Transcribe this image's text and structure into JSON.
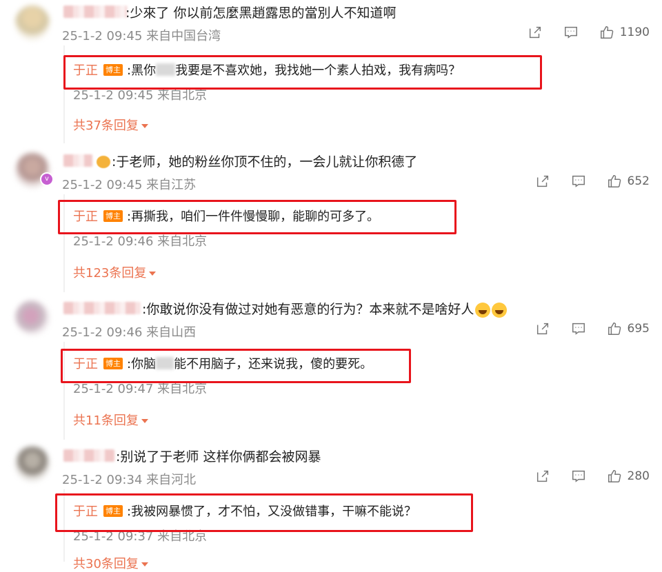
{
  "comments": [
    {
      "text": ":少來了 你以前怎麼黑趙露思的當別人不知道啊",
      "meta": "25-1-2 09:45 来自中国台湾",
      "likes": "1190",
      "reply": {
        "author": "于正",
        "badge": "博主",
        "text_before": ":黑你",
        "text_after": "  我要是不喜欢她，我找她一个素人拍戏，我有病吗？",
        "meta": "25-1-2 09:45 来自北京"
      },
      "more": "共37条回复"
    },
    {
      "text": ":于老师，她的粉丝你顶不住的，一会儿就让你积德了",
      "meta": "25-1-2 09:45 来自江苏",
      "likes": "652",
      "reply": {
        "author": "于正",
        "badge": "博主",
        "text": ":再撕我，咱们一件件慢慢聊，能聊的可多了。",
        "meta": "25-1-2 09:46 来自北京"
      },
      "more": "共123条回复"
    },
    {
      "text": ":你敢说你没有做过对她有恶意的行为？本来就不是啥好人",
      "meta": "25-1-2 09:46 来自山西",
      "likes": "695",
      "reply": {
        "author": "于正",
        "badge": "博主",
        "text_before": ":你脑",
        "text_after": "能不用脑子，还来说我，傻的要死。",
        "meta": "25-1-2 09:47 来自北京"
      },
      "more": "共11条回复"
    },
    {
      "text": ":别说了于老师 这样你俩都会被网暴",
      "meta": "25-1-2 09:34 来自河北",
      "likes": "280",
      "reply": {
        "author": "于正",
        "badge": "博主",
        "text": ":我被网暴惯了，才不怕，又没做错事，干嘛不能说？",
        "meta": "25-1-2 09:37 来自北京"
      },
      "more": "共30条回复"
    }
  ],
  "icons": {
    "share": "share-icon",
    "comment": "comment-icon",
    "like": "like-icon"
  },
  "colors": {
    "author": "#eb7350",
    "host_badge": "#ff8200",
    "highlight_box": "#e8141c",
    "meta": "#8b8b8b"
  }
}
